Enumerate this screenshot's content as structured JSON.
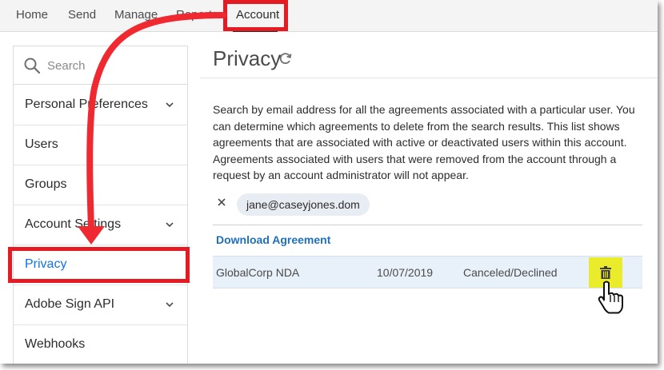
{
  "topnav": {
    "items": [
      {
        "label": "Home"
      },
      {
        "label": "Send"
      },
      {
        "label": "Manage"
      },
      {
        "label": "Reports"
      },
      {
        "label": "Account"
      }
    ],
    "active": "Account"
  },
  "sidebar": {
    "search_placeholder": "Search",
    "items": [
      {
        "label": "Personal Preferences",
        "expandable": true
      },
      {
        "label": "Users",
        "expandable": false
      },
      {
        "label": "Groups",
        "expandable": false
      },
      {
        "label": "Account Settings",
        "expandable": true
      },
      {
        "label": "Privacy",
        "expandable": false,
        "selected": true
      },
      {
        "label": "Adobe Sign API",
        "expandable": true
      },
      {
        "label": "Webhooks",
        "expandable": false
      }
    ]
  },
  "main": {
    "title": "Privacy",
    "description": "Search by email address for all the agreements associated with a particular user. You can determine which agreements to delete from the search results. This list shows agreements that are associated with active or deactivated users within this account. Agreements associated with users that were removed from the account through a request by an account administrator will not appear.",
    "search_chip": "jane@caseyjones.dom",
    "download_label": "Download Agreement",
    "rows": [
      {
        "name": "GlobalCorp NDA",
        "date": "10/07/2019",
        "status": "Canceled/Declined"
      }
    ]
  },
  "colors": {
    "highlight_red": "#e51b24",
    "link_blue": "#1f6fbf",
    "selected_blue": "#1473e6",
    "trash_highlight": "#eaeb2a",
    "row_bg": "#e8f0fa"
  },
  "icons": [
    "search-icon",
    "chevron-down-icon",
    "refresh-icon",
    "close-icon",
    "trash-icon",
    "hand-cursor-icon"
  ]
}
